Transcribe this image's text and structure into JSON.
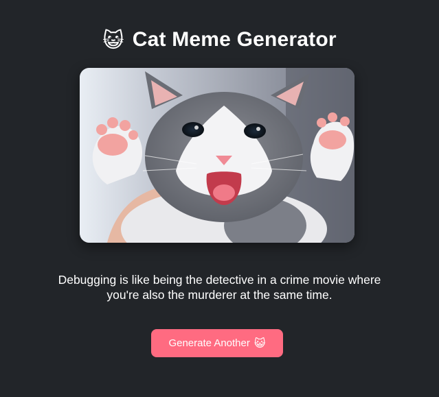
{
  "header": {
    "title_icon": "😺",
    "title": "Cat Meme Generator"
  },
  "meme": {
    "image_subject": "kitten-photo",
    "caption": "Debugging is like being the detective in a crime movie where you're also the murderer at the same time."
  },
  "actions": {
    "generate_label": "Generate Another",
    "generate_icon": "😺"
  },
  "colors": {
    "background": "#222529",
    "accent": "#ff6b81",
    "text": "#ffffff"
  }
}
